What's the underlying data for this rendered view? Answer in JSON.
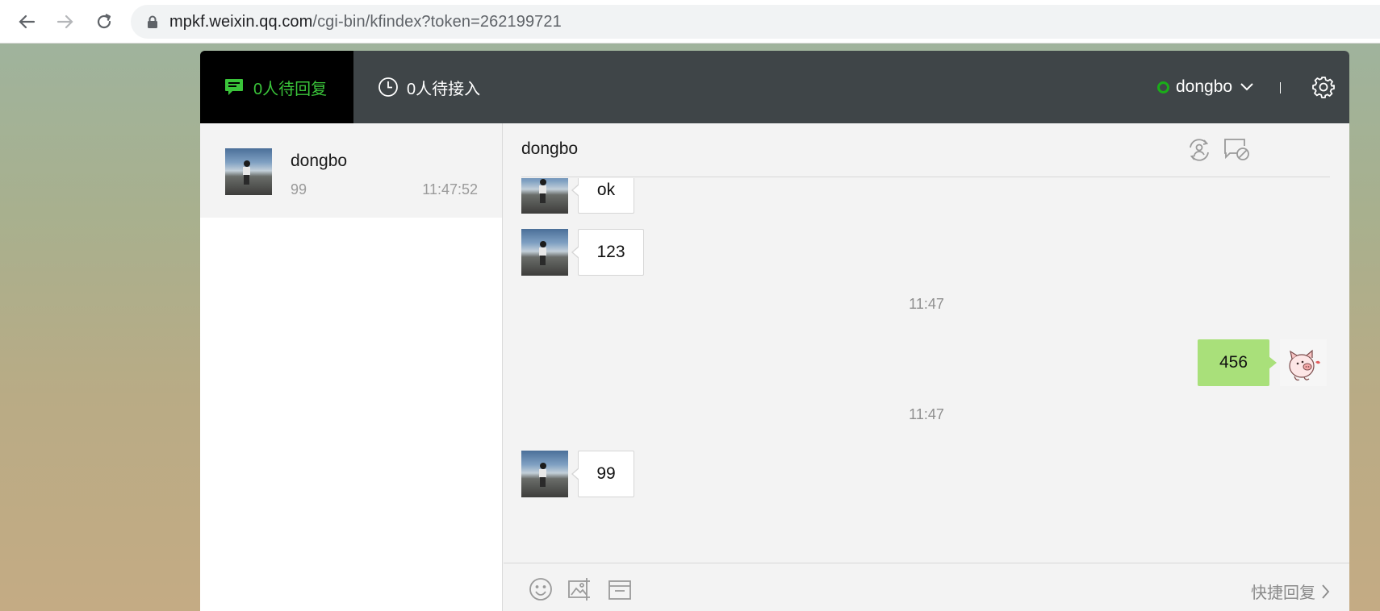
{
  "browser": {
    "url_host": "mpkf.weixin.qq.com",
    "url_path": "/cgi-bin/kfindex?token=262199721",
    "icons": [
      "back-icon",
      "forward-icon",
      "reload-icon",
      "lock-icon"
    ]
  },
  "topbar": {
    "tab_reply_label": "0人待回复",
    "tab_queue_label": "0人待接入",
    "user_name": "dongbo",
    "status_color": "#1aad19",
    "accent_color": "#3ac43a"
  },
  "session_list": [
    {
      "name": "dongbo",
      "preview": "99",
      "time": "11:47:52"
    }
  ],
  "chat": {
    "title": "dongbo",
    "messages": [
      {
        "from": "customer",
        "text": "ok"
      },
      {
        "from": "customer",
        "text": "123"
      },
      {
        "type": "time",
        "text": "11:47"
      },
      {
        "from": "agent",
        "text": "456"
      },
      {
        "type": "time",
        "text": "11:47"
      },
      {
        "from": "customer",
        "text": "99"
      }
    ],
    "bubble_color_agent": "#a9e07a"
  },
  "composer": {
    "quick_reply_label": "快捷回复"
  }
}
